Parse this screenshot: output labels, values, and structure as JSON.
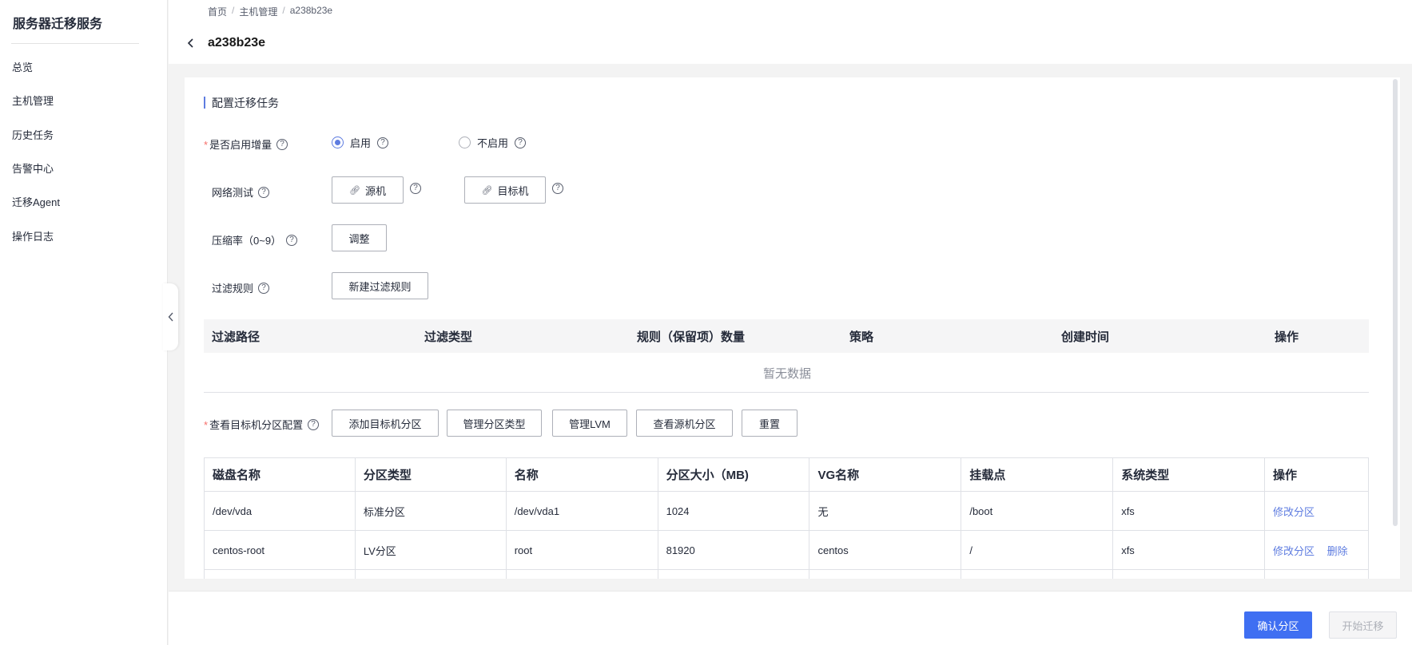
{
  "sidebar": {
    "title": "服务器迁移服务",
    "items": [
      {
        "label": "总览"
      },
      {
        "label": "主机管理"
      },
      {
        "label": "历史任务"
      },
      {
        "label": "告警中心"
      },
      {
        "label": "迁移Agent"
      },
      {
        "label": "操作日志"
      }
    ]
  },
  "header": {
    "breadcrumb": [
      "首页",
      "主机管理",
      "a238b23e"
    ],
    "breadcrumb_sep": "/",
    "title": "a238b23e"
  },
  "section": {
    "title": "配置迁移任务"
  },
  "form": {
    "incremental": {
      "required_mark": "*",
      "label": "是否启用增量",
      "help": "?",
      "options": [
        {
          "label": "启用",
          "checked": true
        },
        {
          "label": "不启用",
          "checked": false
        }
      ]
    },
    "network_test": {
      "label": "网络测试",
      "source_button": "源机",
      "target_button": "目标机"
    },
    "compression": {
      "label": "压缩率（0~9）",
      "button": "调整"
    },
    "filter": {
      "label": "过滤规则",
      "button": "新建过滤规则"
    },
    "partition": {
      "required_mark": "*",
      "label": "查看目标机分区配置",
      "buttons": [
        "添加目标机分区",
        "管理分区类型",
        "管理LVM",
        "查看源机分区",
        "重置"
      ]
    }
  },
  "filter_table": {
    "headers": [
      "过滤路径",
      "过滤类型",
      "规则（保留项）数量",
      "策略",
      "创建时间",
      "操作"
    ],
    "empty": "暂无数据"
  },
  "partition_table": {
    "headers": [
      "磁盘名称",
      "分区类型",
      "名称",
      "分区大小（MB)",
      "VG名称",
      "挂载点",
      "系统类型",
      "操作"
    ],
    "rows": [
      {
        "disk": "/dev/vda",
        "type": "标准分区",
        "name": "/dev/vda1",
        "size": "1024",
        "vg": "无",
        "mount": "/boot",
        "fs": "xfs",
        "actions": [
          "修改分区"
        ]
      },
      {
        "disk": "centos-root",
        "type": "LV分区",
        "name": "root",
        "size": "81920",
        "vg": "centos",
        "mount": "/",
        "fs": "xfs",
        "actions": [
          "修改分区",
          "删除"
        ]
      }
    ]
  },
  "footer": {
    "confirm": "确认分区",
    "start": "开始迁移"
  },
  "colors": {
    "accent": "#5e7ce0",
    "primary_button": "#3f6ff2",
    "required": "#f66f6a"
  }
}
